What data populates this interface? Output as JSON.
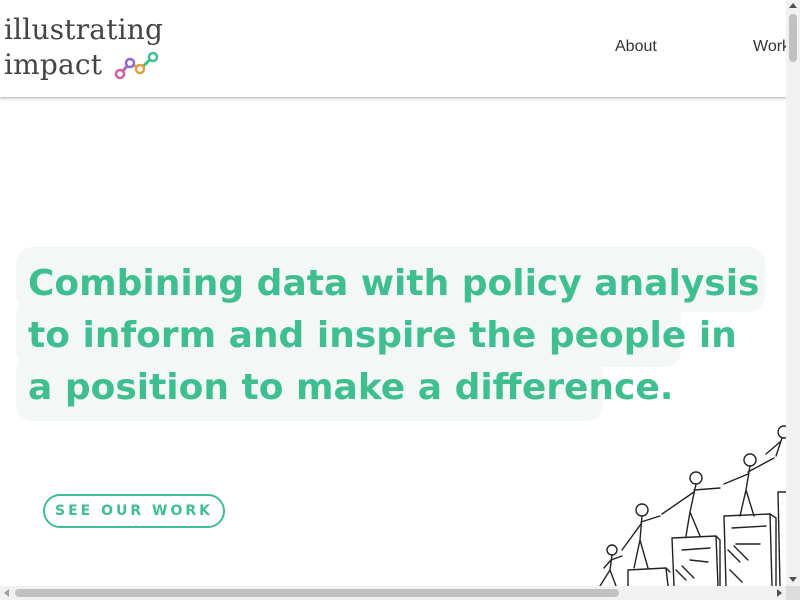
{
  "header": {
    "logo_line1": "illustrating",
    "logo_line2": "impact",
    "logo_mark_icon": "connected-dots-chart-icon",
    "nav": {
      "about": "About",
      "work": "Work"
    }
  },
  "hero": {
    "headline": "Combining data with policy analysis to inform and inspire the people in a position to make a difference.",
    "cta_label": "SEE OUR WORK",
    "illustration_icon": "people-climbing-steps-illustration"
  },
  "colors": {
    "accent": "#3fbf8f",
    "hero_bg": "#f3f8f6",
    "text": "#444444"
  }
}
